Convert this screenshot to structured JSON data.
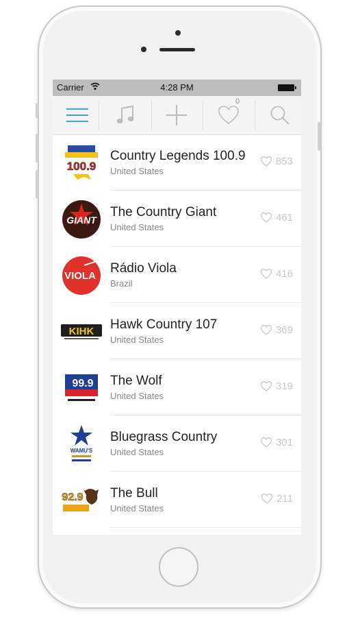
{
  "status_bar": {
    "carrier": "Carrier",
    "time": "4:28 PM"
  },
  "toolbar": {
    "items": [
      {
        "icon": "menu-icon",
        "active": true
      },
      {
        "icon": "music-note-icon"
      },
      {
        "icon": "plus-icon"
      },
      {
        "icon": "heart-icon",
        "badge": "0"
      },
      {
        "icon": "search-icon"
      }
    ]
  },
  "stations": [
    {
      "name": "Country Legends 100.9",
      "country": "United States",
      "favorites": "853",
      "logo_text": "100.9"
    },
    {
      "name": "The Country Giant",
      "country": "United States",
      "favorites": "461",
      "logo_text": "GIANT"
    },
    {
      "name": "Rádio Viola",
      "country": "Brazil",
      "favorites": "416",
      "logo_text": "VIOLA"
    },
    {
      "name": "Hawk Country 107",
      "country": "United States",
      "favorites": "369",
      "logo_text": "KIHK"
    },
    {
      "name": "The Wolf",
      "country": "United States",
      "favorites": "319",
      "logo_text": "99.9"
    },
    {
      "name": "Bluegrass Country",
      "country": "United States",
      "favorites": "301",
      "logo_text": "WAMU'S"
    },
    {
      "name": "The Bull",
      "country": "United States",
      "favorites": "211",
      "logo_text": "92.9"
    }
  ],
  "colors": {
    "accent": "#3aa6d9",
    "icon_gray": "#bcbcbc",
    "status_bar": "#bdbdbd"
  }
}
